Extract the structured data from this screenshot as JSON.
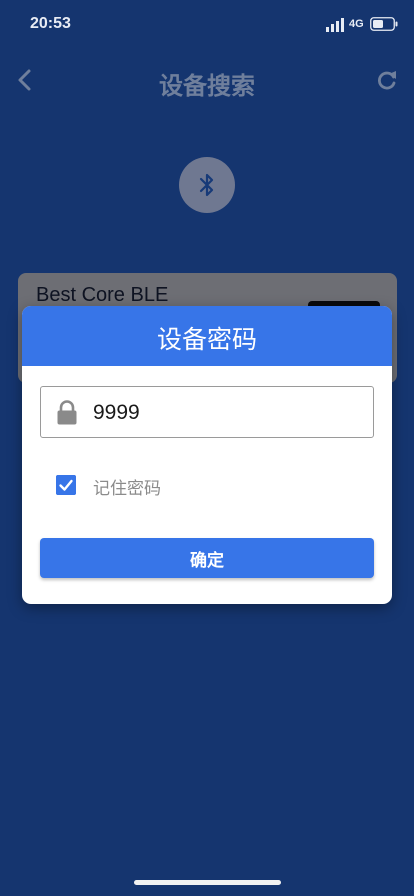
{
  "status_bar": {
    "time": "20:53",
    "network_type": "4G",
    "signal_icon": "signal-bars-icon",
    "battery_icon": "battery-icon"
  },
  "header": {
    "title": "设备搜索",
    "back_icon": "chevron-left-icon",
    "refresh_icon": "refresh-icon"
  },
  "bluetooth": {
    "icon": "bluetooth-icon"
  },
  "device_list": [
    {
      "name": "Best Core BLE"
    }
  ],
  "dialog": {
    "title": "设备密码",
    "password": {
      "value": "9999",
      "icon": "lock-icon"
    },
    "remember": {
      "label": "记住密码",
      "checked": true
    },
    "confirm_label": "确定"
  },
  "colors": {
    "background": "#15356f",
    "accent": "#3775e8",
    "overlay_card": "#6d6e74"
  }
}
